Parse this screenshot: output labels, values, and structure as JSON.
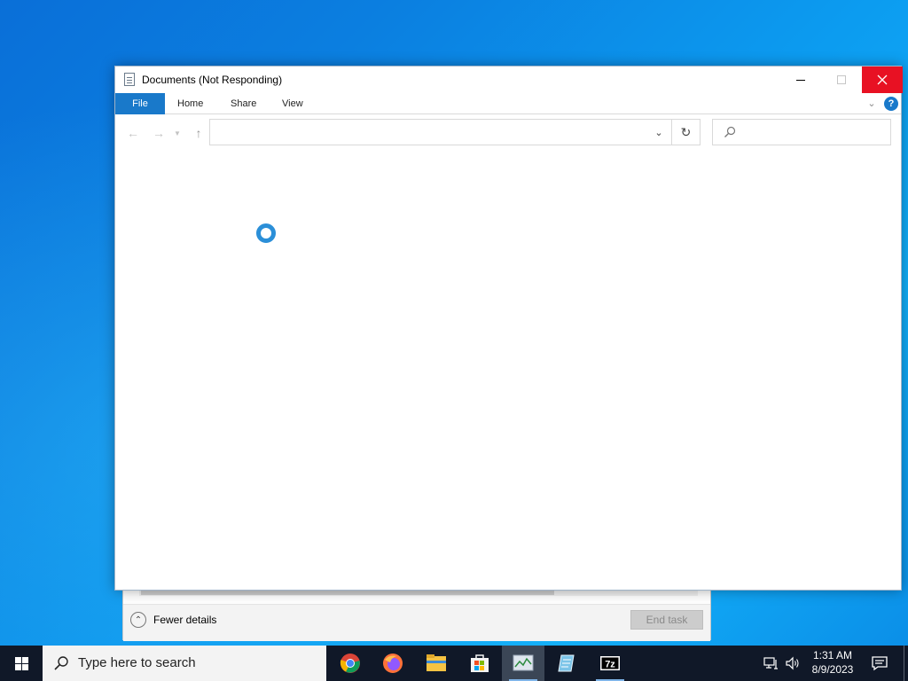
{
  "explorer": {
    "title": "Documents (Not Responding)",
    "ribbon_tabs": [
      "File",
      "Home",
      "Share",
      "View"
    ],
    "address_value": "",
    "search_placeholder": ""
  },
  "task_manager": {
    "fewer_details": "Fewer details",
    "end_task": "End task"
  },
  "taskbar": {
    "search_placeholder": "Type here to search",
    "apps": [
      "chrome-icon",
      "firefox-icon",
      "file-explorer-icon",
      "microsoft-store-icon",
      "task-manager-icon",
      "notepad-icon",
      "7zip-icon"
    ],
    "time": "1:31 AM",
    "date": "8/9/2023"
  },
  "colors": {
    "accent": "#1979ca",
    "close": "#e81123",
    "taskbar": "#101828"
  }
}
